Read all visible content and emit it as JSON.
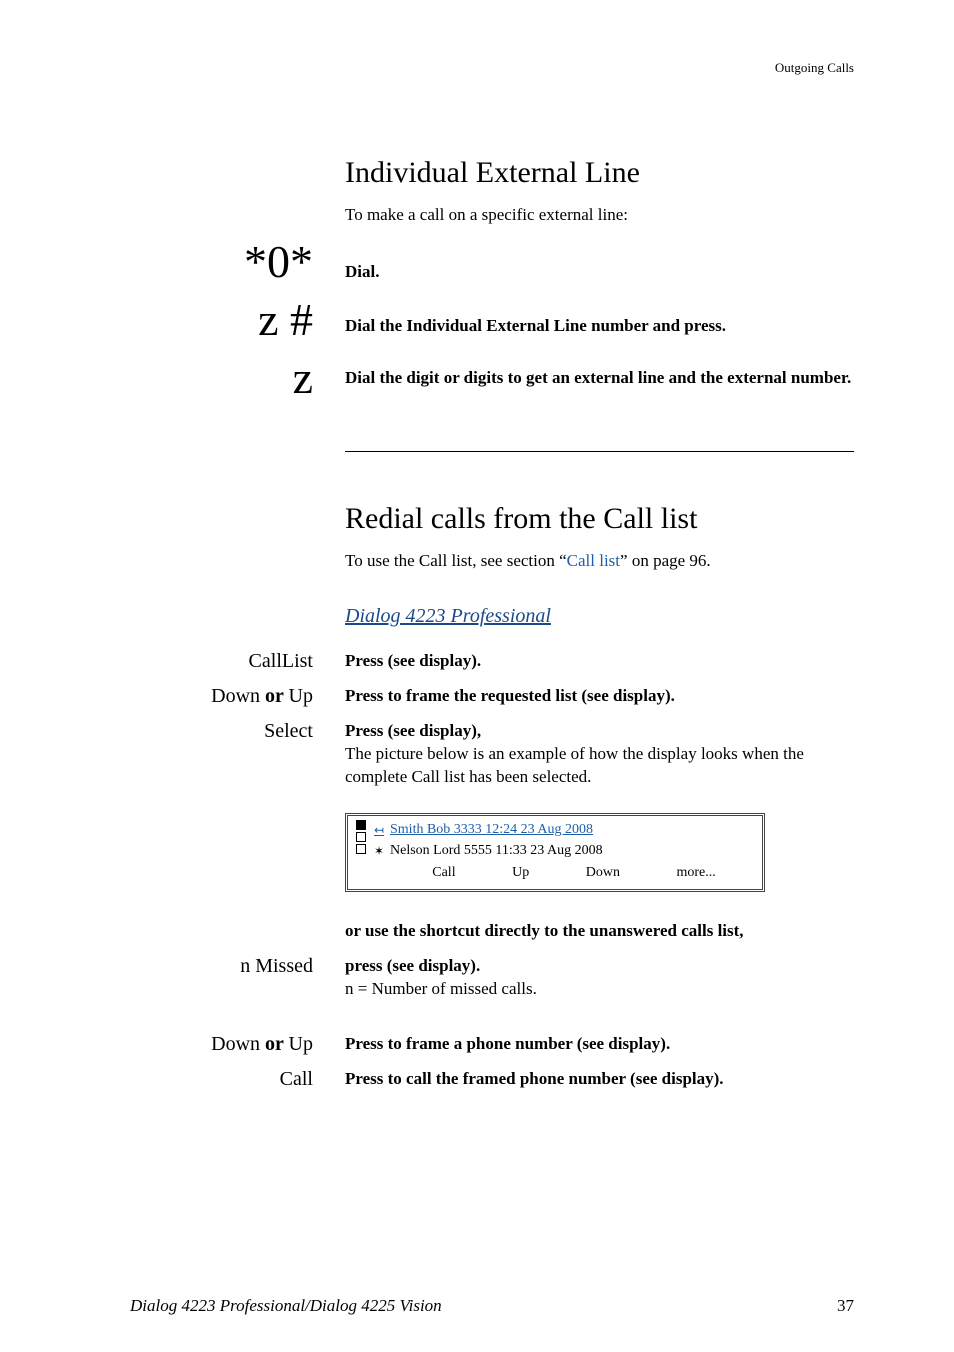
{
  "header": {
    "section": "Outgoing Calls"
  },
  "sec1": {
    "title": "Individual External Line",
    "intro": "To make a call on a specific external line:",
    "sym1": "*0*",
    "sym1_label": "Dial.",
    "sym2": "z #",
    "sym2_label": "Dial the Individual External Line number and press.",
    "sym3": "z",
    "sym3_label": "Dial the digit or digits to get an external line and the external number."
  },
  "sec2": {
    "title": "Redial calls from the Call list",
    "intro_a": "To use the Call list, see section “",
    "intro_link": "Call list",
    "intro_b": "” on page 96.",
    "subhead": "Dialog 4223 Professional",
    "r1_left": "CallList",
    "r1_right": "Press (see display).",
    "r2_left_a": "Down",
    "r2_left_or": " or ",
    "r2_left_b": "Up",
    "r2_right": "Press to frame the requested list (see display).",
    "r3_left": "Select",
    "r3_right_bold": "Press (see display),",
    "r3_right_rest": "The picture below is an example of how the display looks when the complete Call list has been selected.",
    "display": {
      "row1": "Smith Bob 3333   12:24   23 Aug 2008",
      "row2": "Nelson Lord  5555   11:33   23 Aug 2008",
      "k1": "Call",
      "k2": "Up",
      "k3": "Down",
      "k4": "more..."
    },
    "shortcut": "or use the shortcut directly to the unanswered calls list,",
    "r4_left": "n Missed",
    "r4_right_bold": "press (see display).",
    "r4_right_rest": "n = Number of missed calls.",
    "r5_left_a": "Down",
    "r5_left_or": " or ",
    "r5_left_b": "Up",
    "r5_right": "Press to frame a phone number (see display).",
    "r6_left": "Call",
    "r6_right": "Press to call the framed phone number (see display)."
  },
  "footer": {
    "left": "Dialog 4223 Professional/Dialog 4225 Vision",
    "right": "37"
  }
}
